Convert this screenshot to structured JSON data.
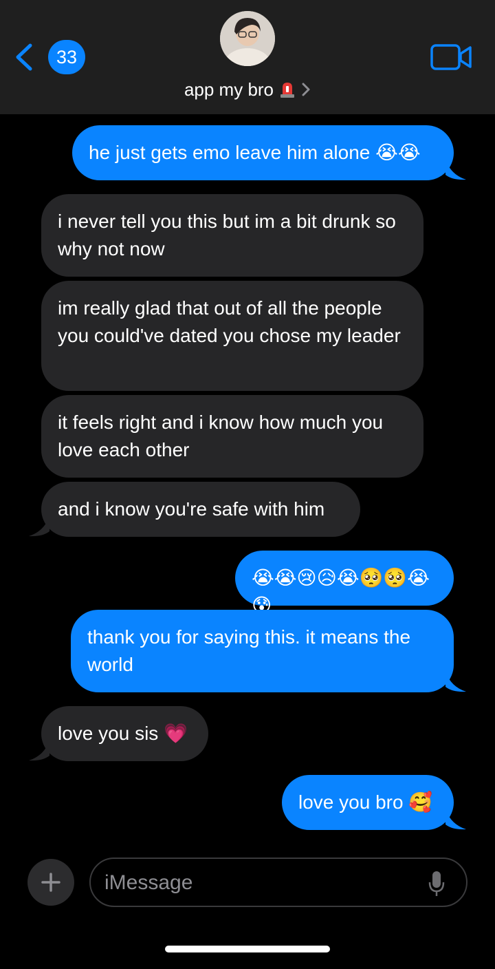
{
  "header": {
    "back_badge_count": "33",
    "contact_name": "app my bro",
    "contact_emoji_icon": "siren-icon"
  },
  "messages": [
    {
      "sender": "me",
      "text": "he just gets emo leave him alone 😭😭"
    },
    {
      "sender": "them",
      "text": "i never tell you this but im a bit drunk so why not now"
    },
    {
      "sender": "them",
      "text": "im really glad that out of all the people you could've dated you chose my leader"
    },
    {
      "sender": "them",
      "text": "it feels right and i know how much you love each other"
    },
    {
      "sender": "them",
      "text": "and i know you're safe with him"
    },
    {
      "sender": "me",
      "text": "😭😭😢😥😭🥺🥺😭😰"
    },
    {
      "sender": "me",
      "text": "thank you for saying this. it means the world"
    },
    {
      "sender": "them",
      "text": "love you sis 💗"
    },
    {
      "sender": "me",
      "text": "love you bro 🥰"
    }
  ],
  "input": {
    "placeholder": "iMessage"
  },
  "colors": {
    "sent_bubble": "#0a84ff",
    "received_bubble": "#262628",
    "header_bg": "#1f1f1f",
    "background": "#000000"
  }
}
